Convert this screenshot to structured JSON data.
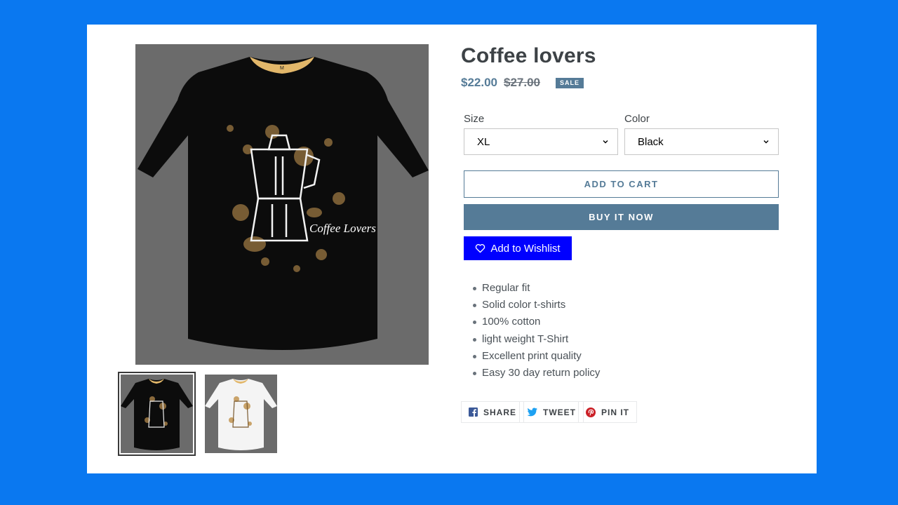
{
  "product": {
    "title": "Coffee lovers",
    "price_sale": "$22.00",
    "price_regular": "$27.00",
    "sale_badge": "SALE",
    "size_label": "Size",
    "size_value": "XL",
    "color_label": "Color",
    "color_value": "Black",
    "add_to_cart": "ADD TO CART",
    "buy_now": "BUY IT NOW",
    "wishlist": "Add to Wishlist",
    "features": [
      "Regular fit",
      "Solid color t-shirts",
      "100% cotton",
      "light weight T-Shirt",
      "Excellent print quality",
      "Easy 30 day return policy"
    ],
    "image_text": "Coffee Lovers"
  },
  "share": {
    "facebook": "SHARE",
    "twitter": "TWEET",
    "pinterest": "PIN IT"
  },
  "colors": {
    "page_bg": "#0a78f0",
    "accent": "#557b97",
    "wishlist_bg": "#0000ff",
    "facebook": "#3b5998",
    "twitter": "#1da1f2",
    "pinterest": "#cb2027"
  }
}
